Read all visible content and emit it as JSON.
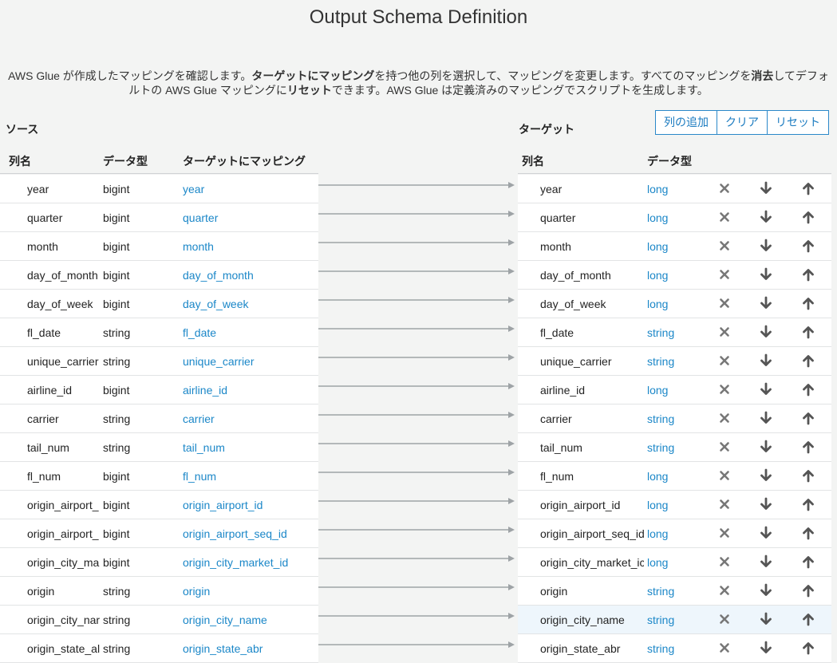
{
  "page": {
    "title": "Output Schema Definition",
    "desc_line1_a": "AWS Glue が作成したマッピングを確認します。",
    "desc_line1_b": "ターゲットにマッピング",
    "desc_line1_c": "を持つ他の列を選択して、マッピングを変更します。すべてのマッピングを",
    "desc_line1_d": "消去",
    "desc_line1_e": "してデフォ",
    "desc_line2_a": "ルトの AWS Glue マッピングに",
    "desc_line2_b": "リセット",
    "desc_line2_c": "できます。AWS Glue は定義済みのマッピングでスクリプトを生成します。"
  },
  "source": {
    "label": "ソース",
    "headers": {
      "name": "列名",
      "type": "データ型",
      "mapping": "ターゲットにマッピング"
    },
    "rows": [
      {
        "name": "year",
        "type": "bigint",
        "map": "year"
      },
      {
        "name": "quarter",
        "type": "bigint",
        "map": "quarter"
      },
      {
        "name": "month",
        "type": "bigint",
        "map": "month"
      },
      {
        "name": "day_of_month",
        "type": "bigint",
        "map": "day_of_month"
      },
      {
        "name": "day_of_week",
        "type": "bigint",
        "map": "day_of_week"
      },
      {
        "name": "fl_date",
        "type": "string",
        "map": "fl_date"
      },
      {
        "name": "unique_carrier",
        "type": "string",
        "map": "unique_carrier"
      },
      {
        "name": "airline_id",
        "type": "bigint",
        "map": "airline_id"
      },
      {
        "name": "carrier",
        "type": "string",
        "map": "carrier"
      },
      {
        "name": "tail_num",
        "type": "string",
        "map": "tail_num"
      },
      {
        "name": "fl_num",
        "type": "bigint",
        "map": "fl_num"
      },
      {
        "name": "origin_airport_",
        "type": "bigint",
        "map": "origin_airport_id"
      },
      {
        "name": "origin_airport_",
        "type": "bigint",
        "map": "origin_airport_seq_id"
      },
      {
        "name": "origin_city_ma",
        "type": "bigint",
        "map": "origin_city_market_id"
      },
      {
        "name": "origin",
        "type": "string",
        "map": "origin"
      },
      {
        "name": "origin_city_nar",
        "type": "string",
        "map": "origin_city_name"
      },
      {
        "name": "origin_state_al",
        "type": "string",
        "map": "origin_state_abr"
      }
    ]
  },
  "target": {
    "label": "ターゲット",
    "headers": {
      "name": "列名",
      "type": "データ型"
    },
    "rows": [
      {
        "name": "year",
        "type": "long"
      },
      {
        "name": "quarter",
        "type": "long"
      },
      {
        "name": "month",
        "type": "long"
      },
      {
        "name": "day_of_month",
        "type": "long"
      },
      {
        "name": "day_of_week",
        "type": "long"
      },
      {
        "name": "fl_date",
        "type": "string"
      },
      {
        "name": "unique_carrier",
        "type": "string"
      },
      {
        "name": "airline_id",
        "type": "long"
      },
      {
        "name": "carrier",
        "type": "string"
      },
      {
        "name": "tail_num",
        "type": "string"
      },
      {
        "name": "fl_num",
        "type": "long"
      },
      {
        "name": "origin_airport_id",
        "type": "long"
      },
      {
        "name": "origin_airport_seq_id",
        "type": "long"
      },
      {
        "name": "origin_city_market_ic",
        "type": "long"
      },
      {
        "name": "origin",
        "type": "string"
      },
      {
        "name": "origin_city_name",
        "type": "string"
      },
      {
        "name": "origin_state_abr",
        "type": "string"
      }
    ],
    "highlighted_row": 15
  },
  "toolbar": {
    "add_column": "列の追加",
    "clear": "クリア",
    "reset": "リセット"
  },
  "icons": {
    "remove": "x-icon",
    "move_down": "arrow-down-icon",
    "move_up": "arrow-up-icon"
  },
  "colors": {
    "link": "#1b87c8",
    "button_border": "#2b88c9",
    "arrow": "#9ea3a6",
    "highlight": "#eef6fc"
  }
}
